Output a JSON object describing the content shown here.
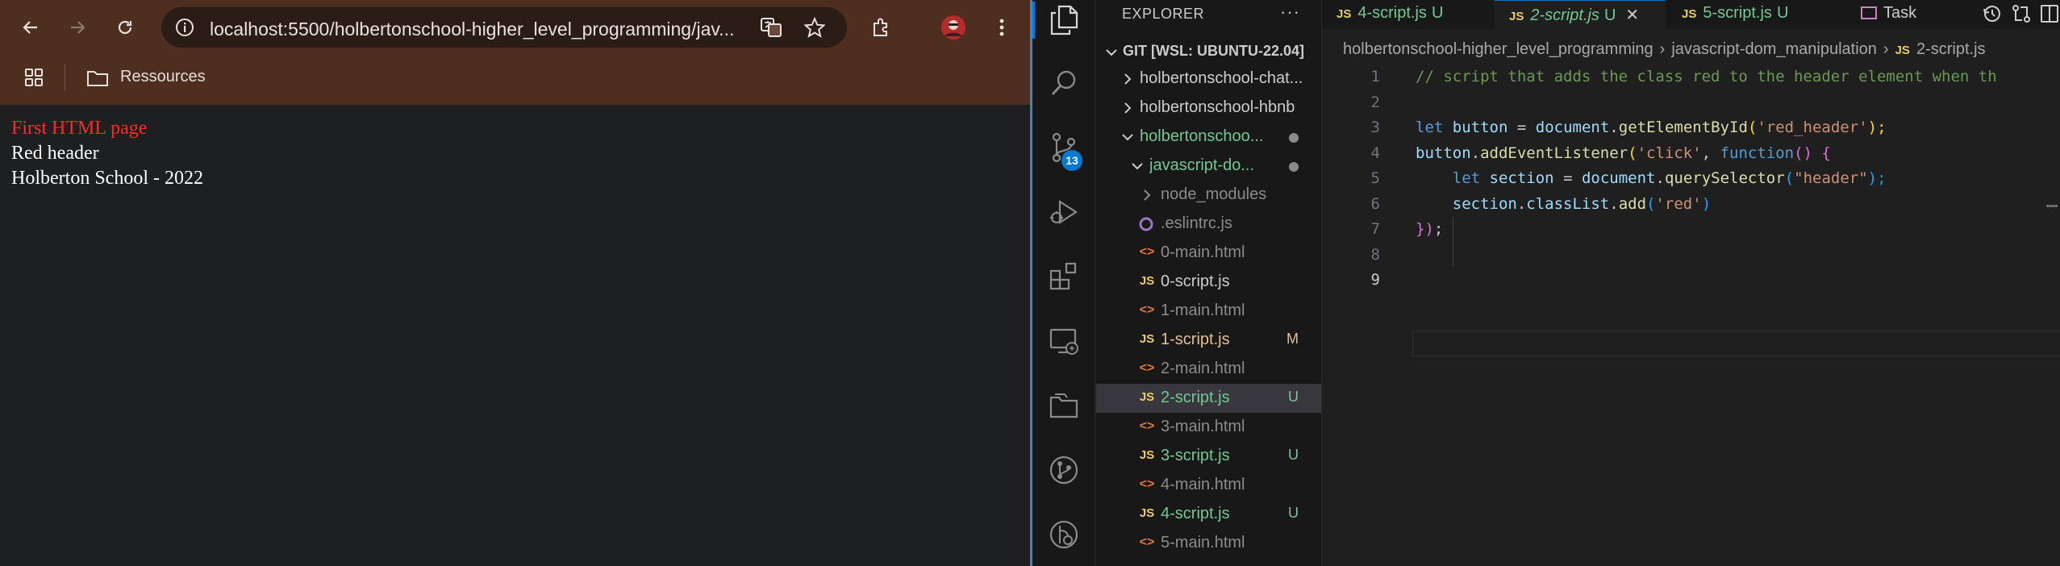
{
  "browser": {
    "url": "localhost:5500/holbertonschool-higher_level_programming/jav...",
    "bookmark_folder": "Ressources",
    "page_lines": [
      "First HTML page",
      "Red header",
      "Holberton School - 2022"
    ]
  },
  "activity": {
    "scm_badge": "13"
  },
  "explorer": {
    "title": "EXPLORER",
    "more": "···",
    "workspace": "GIT [WSL: UBUNTU-22.04]",
    "rows": [
      {
        "name": "holbertonschool-chat...",
        "icon": "",
        "status": ""
      },
      {
        "name": "holbertonschool-hbnb",
        "icon": "",
        "status": ""
      },
      {
        "name": "holbertonschoo...",
        "icon": "",
        "status": ""
      },
      {
        "name": "javascript-do...",
        "icon": "",
        "status": ""
      },
      {
        "name": "node_modules",
        "icon": "",
        "status": ""
      },
      {
        "name": ".eslintrc.js",
        "icon": "eslint-icon",
        "status": ""
      },
      {
        "name": "0-main.html",
        "icon": "html-icon",
        "status": ""
      },
      {
        "name": "0-script.js",
        "icon": "JS",
        "status": ""
      },
      {
        "name": "1-main.html",
        "icon": "html-icon",
        "status": ""
      },
      {
        "name": "1-script.js",
        "icon": "JS",
        "status": "M"
      },
      {
        "name": "2-main.html",
        "icon": "html-icon",
        "status": ""
      },
      {
        "name": "2-script.js",
        "icon": "JS",
        "status": "U"
      },
      {
        "name": "3-main.html",
        "icon": "html-icon",
        "status": ""
      },
      {
        "name": "3-script.js",
        "icon": "JS",
        "status": "U"
      },
      {
        "name": "4-main.html",
        "icon": "html-icon",
        "status": ""
      },
      {
        "name": "4-script.js",
        "icon": "JS",
        "status": "U"
      },
      {
        "name": "5-main.html",
        "icon": "html-icon",
        "status": ""
      }
    ]
  },
  "tabs": [
    {
      "icon": "JS",
      "name": "4-script.js",
      "status": "U"
    },
    {
      "icon": "JS",
      "name": "2-script.js",
      "status": "U",
      "close": "✕"
    },
    {
      "icon": "JS",
      "name": "5-script.js",
      "status": "U"
    },
    {
      "name": "Task"
    }
  ],
  "breadcrumb": [
    "holbertonschool-higher_level_programming",
    "javascript-dom_manipulation",
    "2-script.js"
  ],
  "breadcrumb_js_icon": "JS",
  "line_numbers": [
    "1",
    "2",
    "3",
    "4",
    "5",
    "6",
    "7",
    "8",
    "9"
  ],
  "code": {
    "l1": "// script that adds the class red to the header element when th",
    "l3": [
      "let",
      "button",
      "=",
      "document",
      ".",
      "getElementById",
      "(",
      "'red_header'",
      ");"
    ],
    "l4": [
      "button",
      ".",
      "addEventListener",
      "(",
      "'click'",
      ",",
      "function",
      "()",
      "{"
    ],
    "l5": [
      "let",
      "section",
      "=",
      "document",
      ".",
      "querySelector",
      "(",
      "\"header\"",
      ");"
    ],
    "l6": [
      "section",
      ".",
      "classList",
      ".",
      "add",
      "(",
      "'red'",
      ")"
    ],
    "l7": [
      "})",
      ";"
    ]
  },
  "colors": {
    "accent": "#0078d4",
    "untracked": "#73c991",
    "modified": "#e2c08d",
    "page_title": "#ff2a22"
  }
}
